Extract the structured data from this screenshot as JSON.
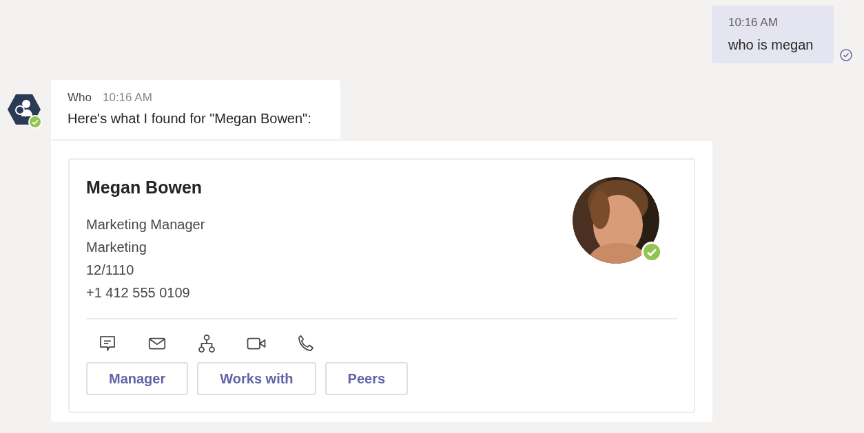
{
  "sent_message": {
    "time": "10:16 AM",
    "text": "who is megan",
    "read": true
  },
  "bot_message": {
    "sender": "Who",
    "time": "10:16 AM",
    "text": "Here's what I found for \"Megan Bowen\":",
    "online": true
  },
  "contact_card": {
    "name": "Megan Bowen",
    "details": [
      "Marketing Manager",
      "Marketing",
      "12/1110",
      "+1 412 555 0109"
    ],
    "online": true,
    "actions": [
      {
        "kind": "chat"
      },
      {
        "kind": "mail"
      },
      {
        "kind": "org"
      },
      {
        "kind": "video"
      },
      {
        "kind": "call"
      }
    ],
    "buttons": [
      "Manager",
      "Works with",
      "Peers"
    ]
  }
}
